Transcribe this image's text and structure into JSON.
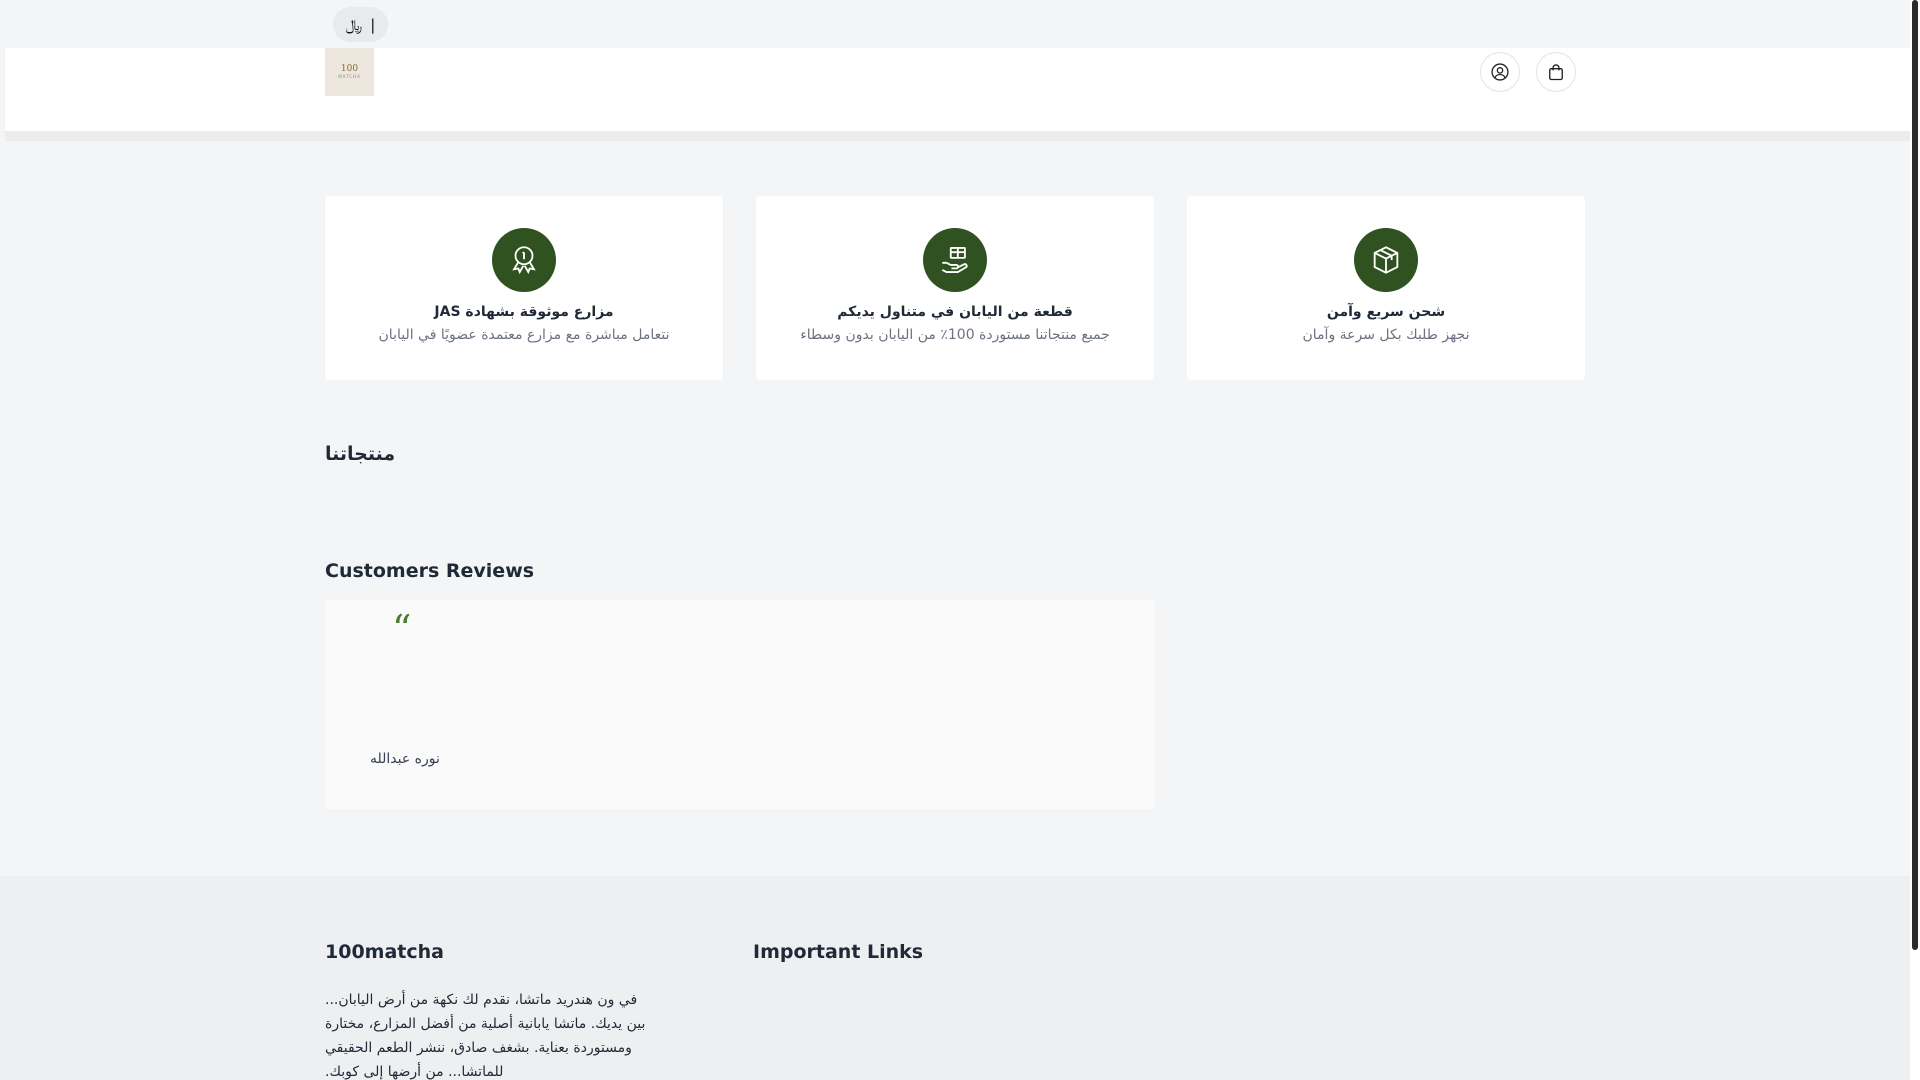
{
  "topbar": {
    "currency_label": "|",
    "currency_symbol": "﷼"
  },
  "header": {
    "logo": {
      "number": "100",
      "word": "MATCHA"
    },
    "icons": {
      "account": "user-circle-icon",
      "cart": "shopping-bag-icon"
    }
  },
  "features": [
    {
      "icon": "award-medal-icon",
      "title": "مزارع موثوقة بشهادة JAS",
      "description": "نتعامل مباشرة مع مزارع معتمدة عضويًا في اليابان"
    },
    {
      "icon": "gift-hand-icon",
      "title": "قطعة من اليابان في متناول يديكم",
      "description": "جميع منتجاتنا مستوردة 100٪ من اليابان بدون وسطاء"
    },
    {
      "icon": "box-package-icon",
      "title": "شحن سريع وآمن",
      "description": "نجهز طلبك بكل سرعة وآمان"
    }
  ],
  "products": {
    "title": "منتجاتنا"
  },
  "reviews": {
    "title": "Customers Reviews",
    "items": [
      {
        "quote_mark": "“",
        "reviewer": "نوره عبدالله"
      }
    ]
  },
  "footer": {
    "brand": "100matcha",
    "links_title": "Important Links",
    "about": "في ون هندريد ماتشا، نقدم لك نكهة من أرض اليابان... بين يديك. ماتشا يابانية أصلية من أفضل المزارع، مختارة ومستوردة بعناية. بشغف صادق، ننشر الطعم الحقيقي للماتشا... من أرضها إلى كوبك."
  },
  "colors": {
    "accent": "#2f5220",
    "quote": "#4b7a33"
  }
}
